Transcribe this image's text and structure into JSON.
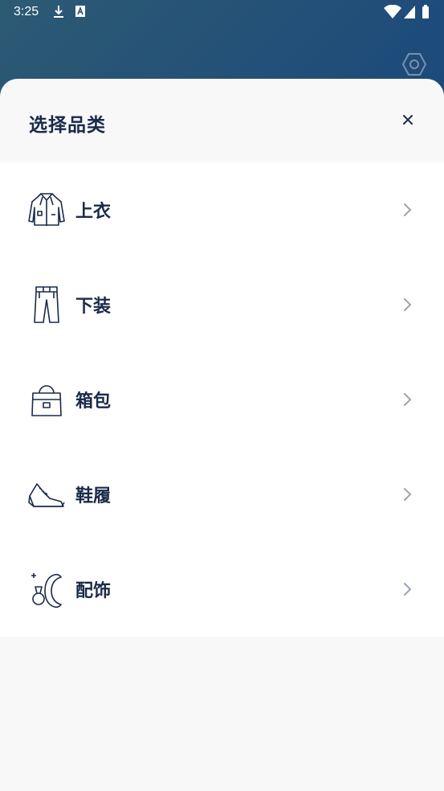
{
  "status_bar": {
    "time": "3:25"
  },
  "sheet": {
    "title": "选择品类",
    "categories": [
      {
        "label": "上衣",
        "icon": "jacket-icon"
      },
      {
        "label": "下装",
        "icon": "pants-icon"
      },
      {
        "label": "箱包",
        "icon": "bag-icon"
      },
      {
        "label": "鞋履",
        "icon": "shoe-icon"
      },
      {
        "label": "配饰",
        "icon": "accessory-icon"
      }
    ]
  },
  "colors": {
    "text": "#1a2a4a",
    "accent": "#123d78",
    "sheet_bg": "#f8f8f9"
  }
}
